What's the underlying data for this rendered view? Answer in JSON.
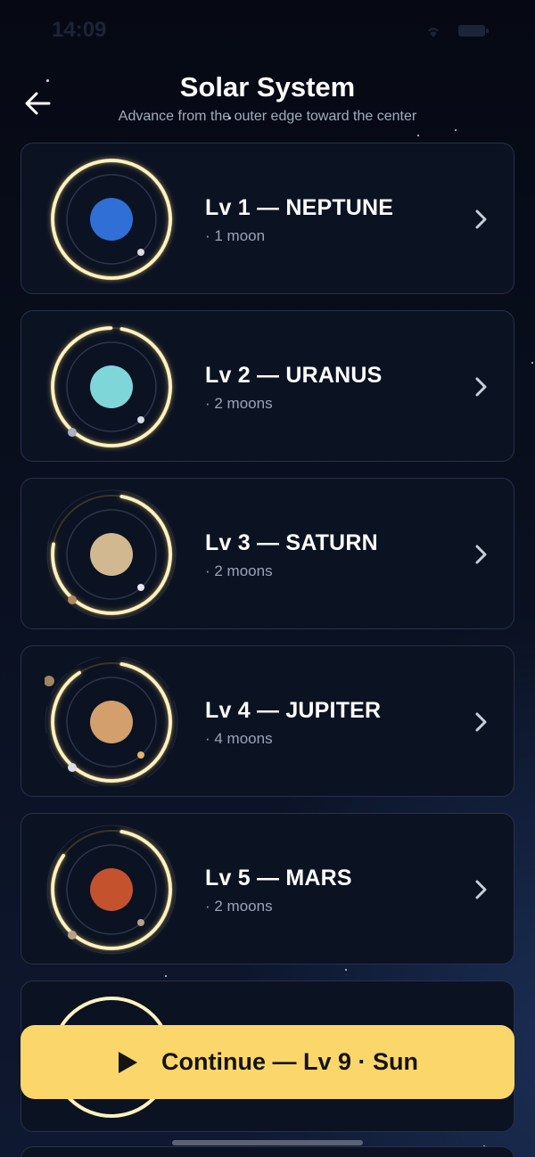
{
  "status_bar": {
    "time": "14:09"
  },
  "header": {
    "title": "Solar System",
    "subtitle": "Advance from the outer edge toward the center"
  },
  "levels": [
    {
      "title": "Lv 1 — NEPTUNE",
      "subtitle": "· 1 moon",
      "planet_color": "#2f6fd6",
      "progress": 1.0
    },
    {
      "title": "Lv 2 — URANUS",
      "subtitle": "· 2 moons",
      "planet_color": "#7fd6d9",
      "progress": 0.97
    },
    {
      "title": "Lv 3 — SATURN",
      "subtitle": "· 2 moons",
      "planet_color": "#d2b890",
      "progress": 0.75
    },
    {
      "title": "Lv 4 — JUPITER",
      "subtitle": "· 4 moons",
      "planet_color": "#d39f6c",
      "progress": 0.88
    },
    {
      "title": "Lv 5 — MARS",
      "subtitle": "· 2 moons",
      "planet_color": "#c4532d",
      "progress": 0.82
    }
  ],
  "continue_button": {
    "label": "Continue — Lv 9 · Sun",
    "icon": "play-icon"
  },
  "colors": {
    "accent": "#fbd66a",
    "ring": "#fff2bf",
    "card_bg": "#0b1222",
    "card_border": "#27314a",
    "background": "#070b16"
  }
}
